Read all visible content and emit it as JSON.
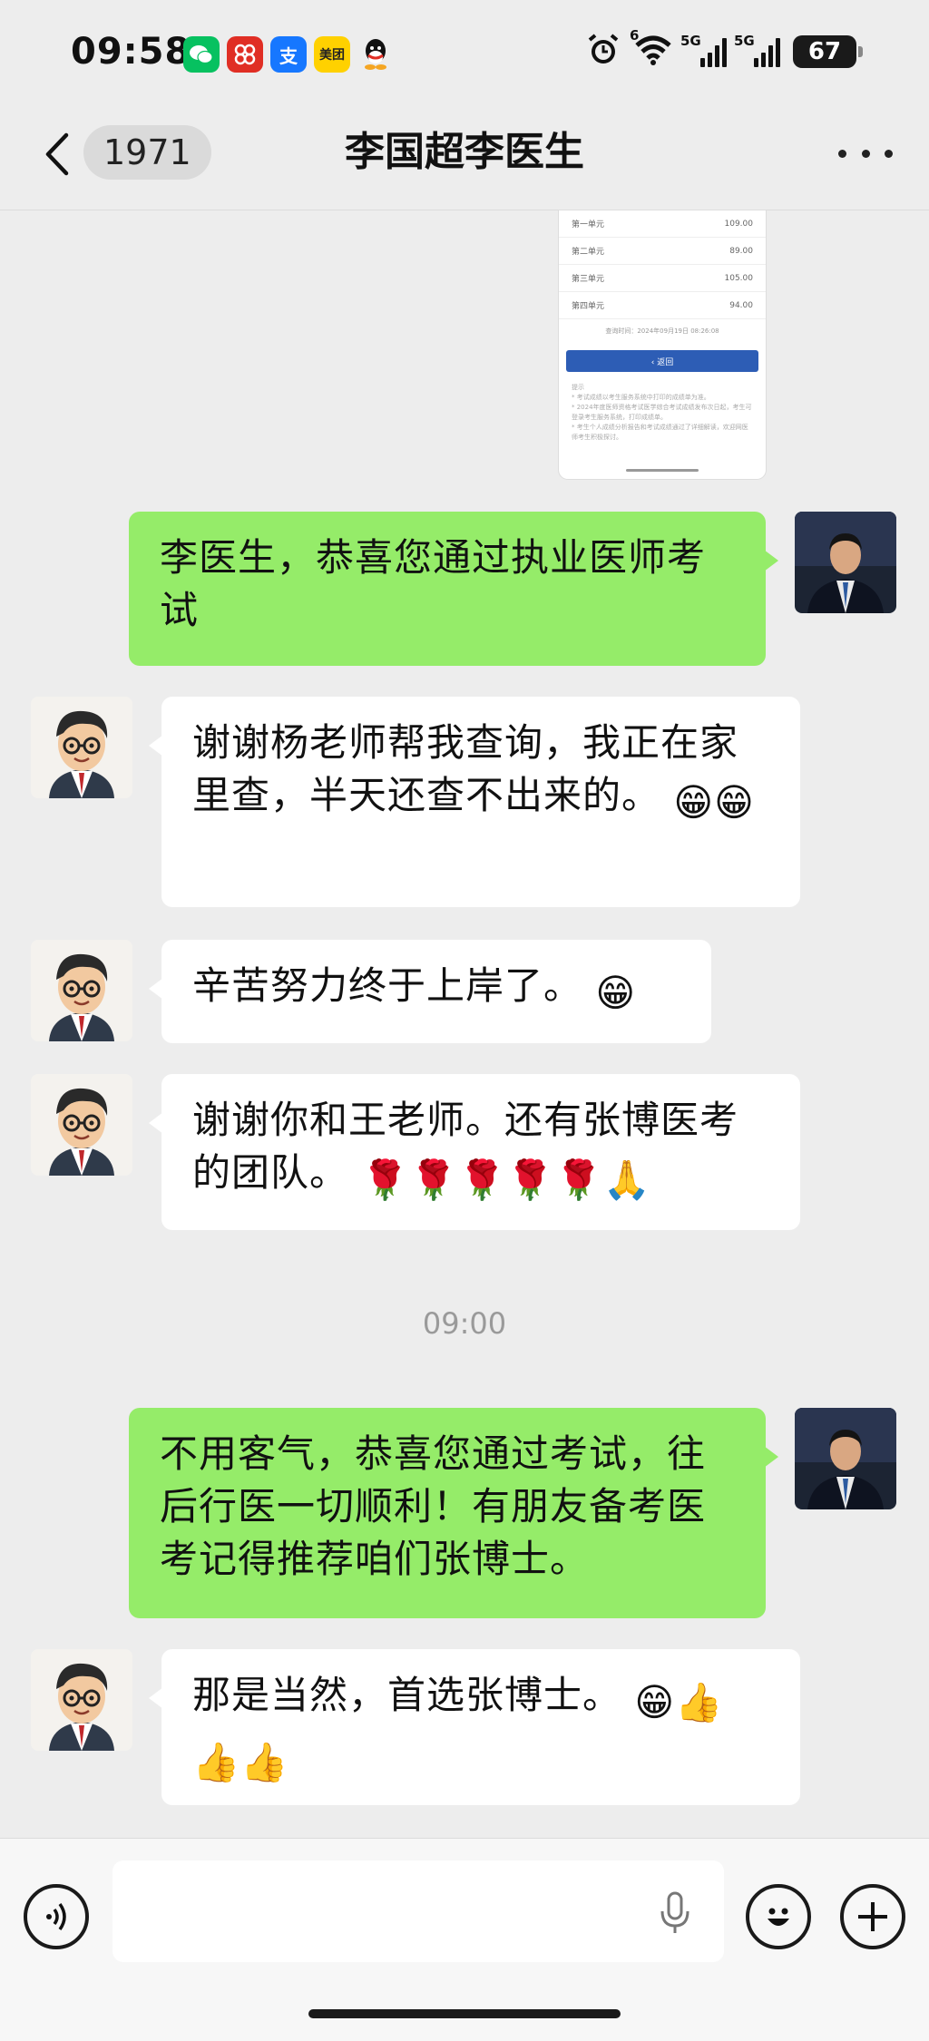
{
  "status_bar": {
    "time": "09:58",
    "apps": [
      {
        "name": "wechat",
        "color": "#07C160"
      },
      {
        "name": "pinduoduo",
        "color": "#E02E24"
      },
      {
        "name": "alipay",
        "color": "#1677FF",
        "label": "支"
      },
      {
        "name": "meituan",
        "color": "#FFD100",
        "label": "美团"
      },
      {
        "name": "qq",
        "color": "#000000"
      }
    ],
    "wifi_label": "6",
    "network1": "5G",
    "network2": "5G",
    "battery": "67"
  },
  "header": {
    "unread_count": "1971",
    "title": "李国超李医生"
  },
  "screenshot_image": {
    "rows": [
      {
        "label": "第一单元",
        "value": "109.00"
      },
      {
        "label": "第二单元",
        "value": "89.00"
      },
      {
        "label": "第三单元",
        "value": "105.00"
      },
      {
        "label": "第四单元",
        "value": "94.00"
      }
    ],
    "query_time": "查询时间：2024年09月19日 08:26:08",
    "button_label": "‹ 返回",
    "notes": "提示\n* 考试成绩以考生服务系统中打印的成绩单为准。\n* 2024年度医师资格考试医学综合考试成绩发布次日起，考生可登录考生服务系统，打印成绩单。\n* 考生个人成绩分析报告和考试成绩通过了详细解读，欢迎网医师考生积极探讨。"
  },
  "messages": [
    {
      "side": "out",
      "text": "李医生，恭喜您通过执业医师考试"
    },
    {
      "side": "in",
      "text": "谢谢杨老师帮我查询，我正在家里查，半天还查不出来的。",
      "emoji": [
        "😁",
        "😁"
      ]
    },
    {
      "side": "in",
      "text": "辛苦努力终于上岸了。",
      "emoji": [
        "😁"
      ]
    },
    {
      "side": "in",
      "text": "谢谢你和王老师。还有张博医考的团队。",
      "emoji": [
        "🌹",
        "🌹",
        "🌹",
        "🌹",
        "🌹",
        "🙏"
      ]
    },
    {
      "side": "out",
      "text": "不用客气，恭喜您通过考试，往后行医一切顺利！有朋友备考医考记得推荐咱们张博士。"
    },
    {
      "side": "in",
      "text": "那是当然，首选张博士。",
      "emoji": [
        "😁",
        "👍",
        "👍",
        "👍"
      ]
    }
  ],
  "timestamp": "09:00",
  "input_bar": {
    "placeholder": ""
  },
  "colors": {
    "background": "#EDEDED",
    "out_bubble": "#95EC69",
    "in_bubble": "#FFFFFF"
  }
}
